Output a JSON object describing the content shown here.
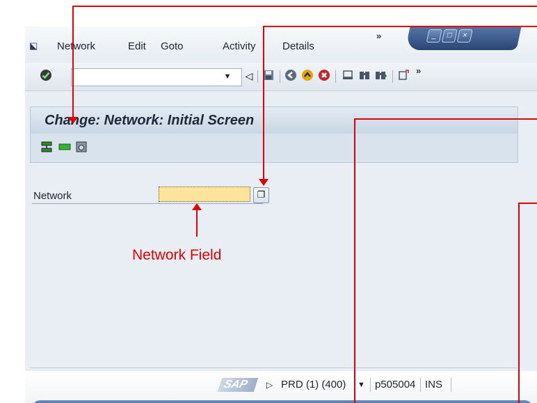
{
  "menubar": {
    "items": [
      {
        "label": "Network"
      },
      {
        "label": "Edit"
      },
      {
        "label": "Goto"
      },
      {
        "label": "Activity"
      },
      {
        "label": "Details"
      }
    ],
    "overflow": "»"
  },
  "window_controls": {
    "minimize": "_",
    "maximize": "□",
    "close": "×"
  },
  "toolbar": {
    "command_field_value": "",
    "overflow": "»",
    "icons": [
      "enter-icon",
      "save-icon",
      "back-icon",
      "exit-icon",
      "cancel-icon",
      "print-icon",
      "find-icon",
      "find-next-icon",
      "create-session-icon"
    ]
  },
  "page": {
    "title": "Change: Network: Initial Screen"
  },
  "app_toolbar": {
    "icons": [
      "network-structure-icon",
      "activity-overview-icon",
      "project-info-icon"
    ]
  },
  "form": {
    "network_label": "Network",
    "network_value": ""
  },
  "statusbar": {
    "logo": "SAP",
    "system": "PRD (1) (400)",
    "server": "p505004",
    "mode": "INS"
  },
  "annotation": {
    "caption": "Network Field",
    "color": "#e00000"
  },
  "colors": {
    "input_required": "#fde49a",
    "accent_blue": "#3a5a8c"
  }
}
